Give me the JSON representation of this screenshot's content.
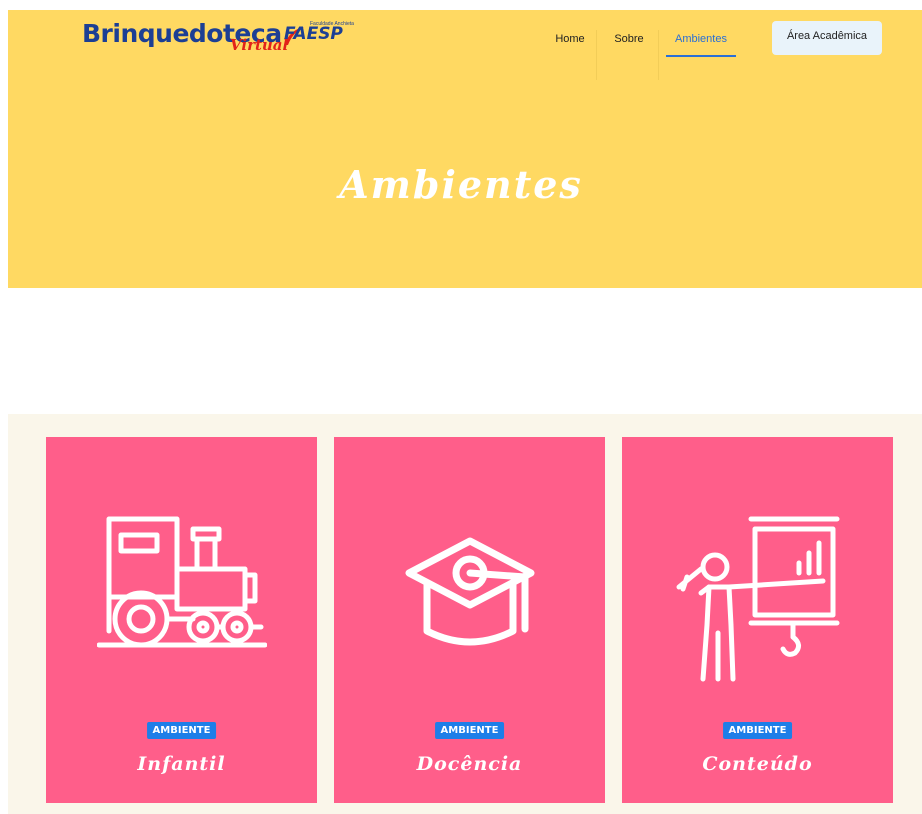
{
  "brand": {
    "name": "Brinquedoteca",
    "sub": "Virtual",
    "partner": "FAESP",
    "partner_tagline": "Faculdade Anchieta"
  },
  "nav": {
    "items": [
      {
        "label": "Home"
      },
      {
        "label": "Sobre"
      },
      {
        "label": "Ambientes"
      }
    ],
    "active": "Ambientes",
    "cta_label": "Área Acadêmica"
  },
  "hero": {
    "title": "Ambientes"
  },
  "cards": [
    {
      "badge": "AMBIENTE",
      "title": "Infantil",
      "icon": "train-icon"
    },
    {
      "badge": "AMBIENTE",
      "title": "Docência",
      "icon": "graduation-cap-icon"
    },
    {
      "badge": "AMBIENTE",
      "title": "Conteúdo",
      "icon": "presentation-board-icon"
    }
  ],
  "colors": {
    "hero_bg": "#ffd962",
    "card_bg": "#ff5e8a",
    "band_bg": "#faf6ea",
    "badge_bg": "#1e7ee8",
    "accent": "#2a6fd6",
    "logo_blue": "#1c3f94",
    "logo_red": "#e2231a"
  }
}
